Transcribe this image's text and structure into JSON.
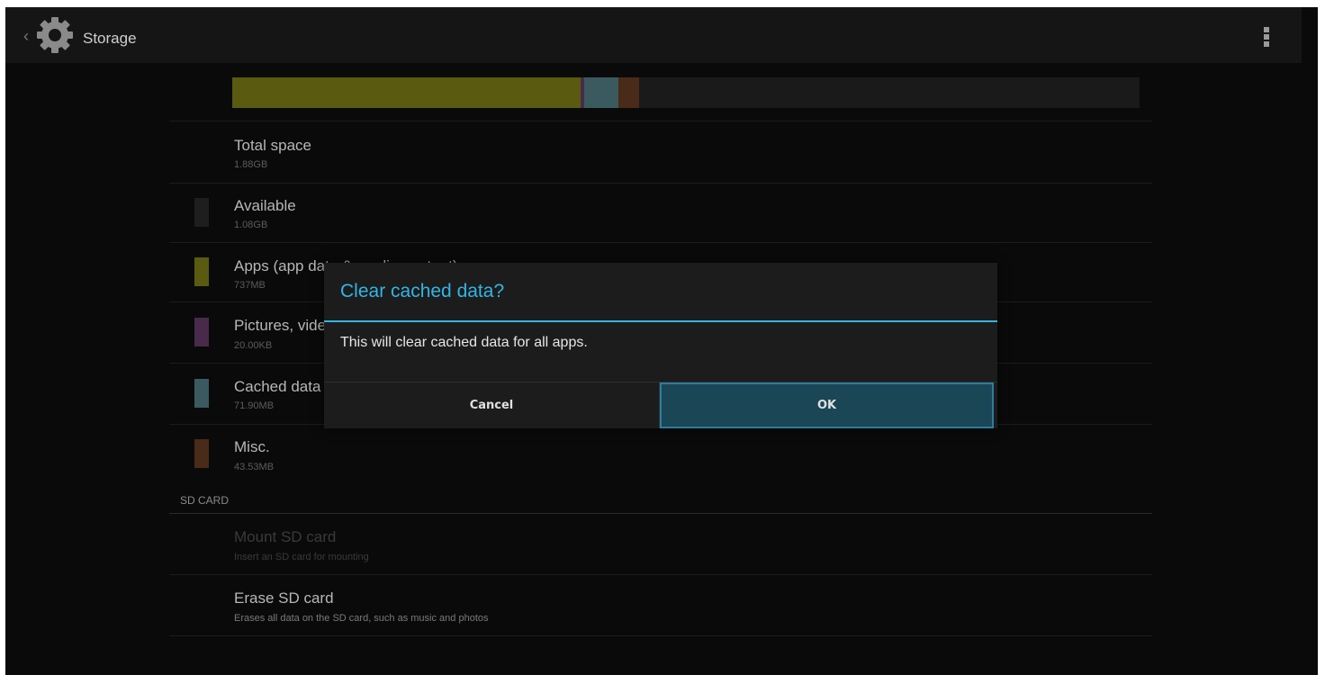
{
  "actionbar": {
    "title": "Storage",
    "back_glyph": "‹",
    "icon": "gear-icon",
    "overflow_icon": "overflow-menu-icon"
  },
  "storage_bar": {
    "segments": [
      {
        "name": "apps",
        "fraction": 0.384,
        "color": "#5a5a10"
      },
      {
        "name": "pictures",
        "fraction": 0.004,
        "color": "#4a2a4a"
      },
      {
        "name": "cached",
        "fraction": 0.038,
        "color": "#3a5a60"
      },
      {
        "name": "misc",
        "fraction": 0.022,
        "color": "#4a2a18"
      },
      {
        "name": "available",
        "fraction": 0.552,
        "color": "#1a1a1a"
      }
    ]
  },
  "items": [
    {
      "label": "Total space",
      "value": "1.88GB"
    },
    {
      "label": "Available",
      "value": "1.08GB",
      "color": "#1e1e1e"
    },
    {
      "label": "Apps (app data & media content)",
      "value": "737MB",
      "color": "#5a5a10"
    },
    {
      "label": "Pictures, videos",
      "value": "20.00KB",
      "color": "#4a2a4a"
    },
    {
      "label": "Cached data",
      "value": "71.90MB",
      "color": "#3a5a60"
    },
    {
      "label": "Misc.",
      "value": "43.53MB",
      "color": "#4a2a18"
    }
  ],
  "sd_section": "SD CARD",
  "sd_items": [
    {
      "label": "Mount SD card",
      "summary": "Insert an SD card for mounting"
    },
    {
      "label": "Erase SD card",
      "summary": "Erases all data on the SD card, such as music and photos"
    }
  ],
  "dialog": {
    "title": "Clear cached data?",
    "message": "This will clear cached data for all apps.",
    "cancel": "Cancel",
    "ok": "OK"
  },
  "colors": {
    "accent": "#33b5e5"
  }
}
